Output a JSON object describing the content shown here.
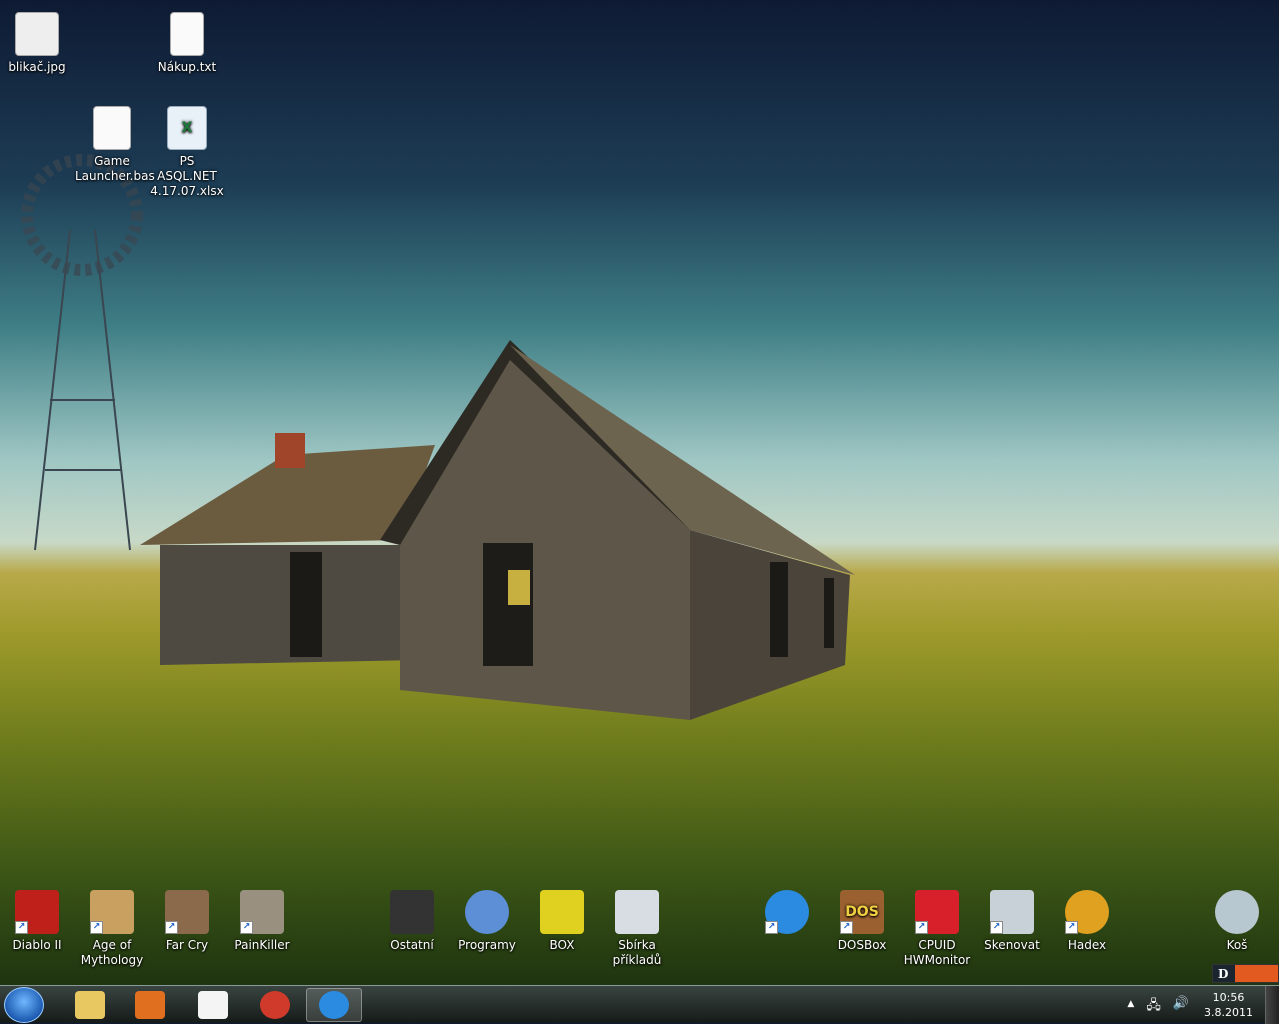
{
  "desktop_icons_top": [
    {
      "label": "blikač.jpg",
      "icon": "image-file-icon"
    },
    {
      "label": "Nákup.txt",
      "icon": "text-file-icon"
    },
    {
      "label": "Game Launcher.bas",
      "icon": "bas-file-icon"
    },
    {
      "label": "PS ASQL.NET 4.17.07.xlsx",
      "icon": "excel-file-icon"
    }
  ],
  "desktop_icons_bottom": [
    {
      "label": "Diablo II",
      "icon": "diablo-icon",
      "color": "#c0201a"
    },
    {
      "label": "Age of Mythology",
      "icon": "age-of-mythology-icon",
      "color": "#c9a060"
    },
    {
      "label": "Far Cry",
      "icon": "far-cry-icon",
      "color": "#8a6a4a"
    },
    {
      "label": "PainKiller",
      "icon": "painkiller-icon",
      "color": "#9a9080"
    },
    {
      "label": "Ostatní",
      "icon": "chip-folder-icon",
      "color": "#333"
    },
    {
      "label": "Programy",
      "icon": "pie-folder-icon",
      "color": "#5c8fd6"
    },
    {
      "label": "BOX",
      "icon": "keys-icon",
      "color": "#e0d020"
    },
    {
      "label": "Sbírka příkladů",
      "icon": "printer-icon",
      "color": "#d8dde3"
    },
    {
      "label": "",
      "icon": "internet-explorer-icon",
      "color": "#2a8be0"
    },
    {
      "label": "DOSBox",
      "icon": "dosbox-icon",
      "color": "#9a6030"
    },
    {
      "label": "CPUID HWMonitor",
      "icon": "hwmonitor-icon",
      "color": "#d8202a"
    },
    {
      "label": "Skenovat",
      "icon": "scanner-icon",
      "color": "#c8d0d8"
    },
    {
      "label": "Hadex",
      "icon": "chrome-icon",
      "color": "#e0a020"
    },
    {
      "label": "Koš",
      "icon": "recycle-bin-icon",
      "color": "#b8c8d0"
    }
  ],
  "dosbox_glyph": "DOS",
  "dbar_label": "D",
  "taskbar": {
    "items": [
      {
        "name": "explorer",
        "icon": "file-explorer-icon",
        "color": "#e8c860"
      },
      {
        "name": "media-player",
        "icon": "media-player-icon",
        "color": "#e07020"
      },
      {
        "name": "language-bar",
        "icon": "translate-icon",
        "color": "#f4f4f4"
      },
      {
        "name": "chrome",
        "icon": "chrome-icon",
        "color": "#d03a2a"
      },
      {
        "name": "internet-explorer",
        "icon": "internet-explorer-icon",
        "color": "#2a8be0"
      }
    ],
    "tray_arrow": "▲",
    "network": "🖧",
    "volume": "🔊",
    "time": "10:56",
    "date": "3.8.2011"
  }
}
